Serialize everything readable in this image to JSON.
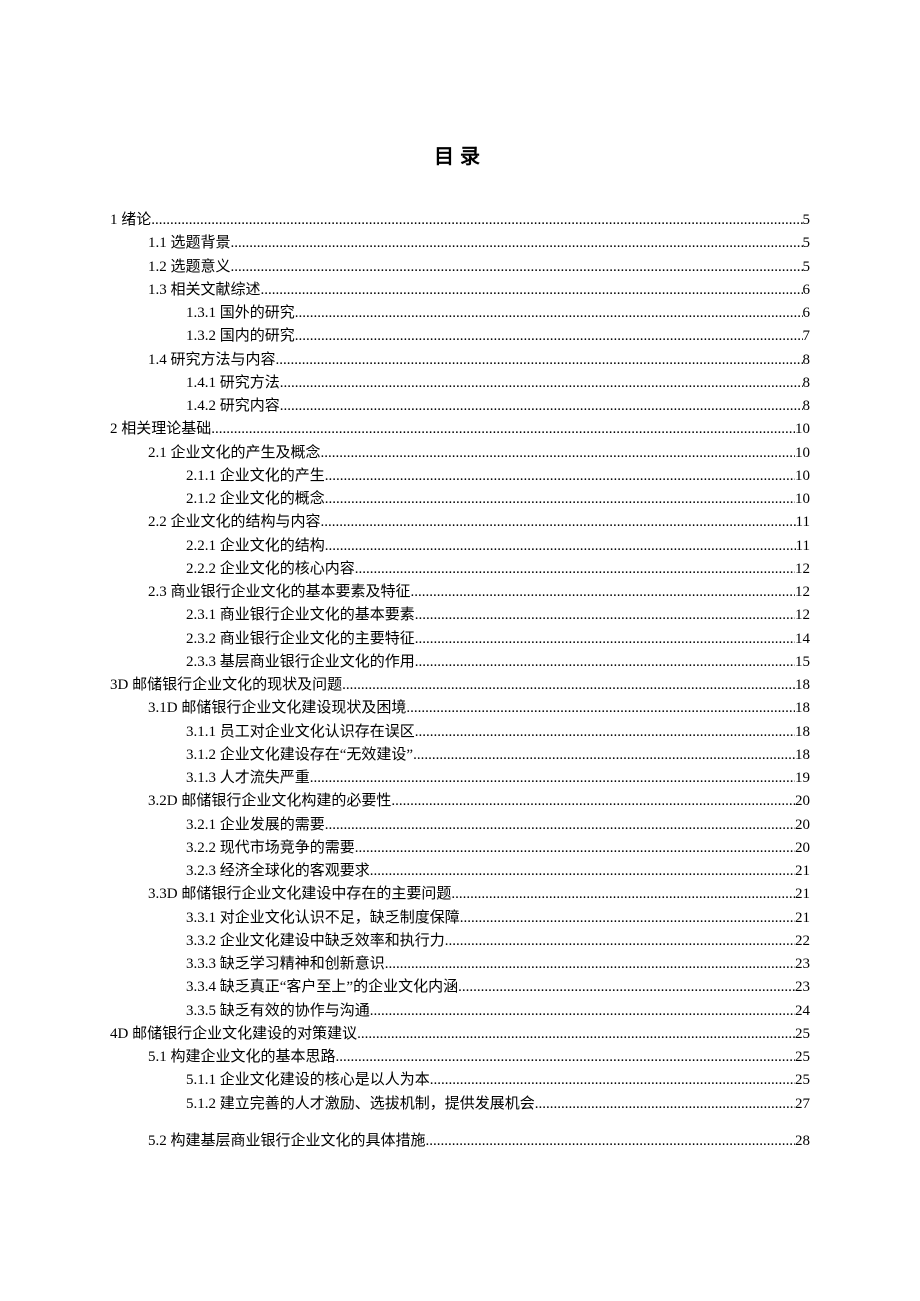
{
  "title": "目录",
  "entries": [
    {
      "level": 0,
      "num": "1 ",
      "text": "绪论 ",
      "page": "5"
    },
    {
      "level": 1,
      "num": "1.1 ",
      "text": "选题背景",
      "page": "5"
    },
    {
      "level": 1,
      "num": "1.2 ",
      "text": "选题意义",
      "page": "5"
    },
    {
      "level": 1,
      "num": "1.3 ",
      "text": "相关文献综述 ",
      "page": "6"
    },
    {
      "level": 2,
      "num": "1.3.1 ",
      "text": "国外的研究",
      "page": "6"
    },
    {
      "level": 2,
      "num": "1.3.2 ",
      "text": "国内的研究",
      "page": "7"
    },
    {
      "level": 1,
      "num": "1.4 ",
      "text": "研究方法与内容",
      "page": "8"
    },
    {
      "level": 2,
      "num": "1.4.1 ",
      "text": "研究方法 ",
      "page": "8"
    },
    {
      "level": 2,
      "num": "1.4.2 ",
      "text": "研究内容 ",
      "page": "8"
    },
    {
      "level": 0,
      "num": "2 ",
      "text": "相关理论基础",
      "page": "10"
    },
    {
      "level": 1,
      "num": "2.1 ",
      "text": "企业文化的产生及概念",
      "page": "10"
    },
    {
      "level": 2,
      "num": "2.1.1 ",
      "text": "企业文化的产生 ",
      "page": "10"
    },
    {
      "level": 2,
      "num": "2.1.2 ",
      "text": "企业文化的概念 ",
      "page": "10"
    },
    {
      "level": 1,
      "num": "2.2 ",
      "text": "企业文化的结构与内容",
      "page": "11"
    },
    {
      "level": 2,
      "num": "2.2.1 ",
      "text": "企业文化的结构 ",
      "page": "11"
    },
    {
      "level": 2,
      "num": "2.2.2 ",
      "text": "企业文化的核心内容 ",
      "page": "12"
    },
    {
      "level": 1,
      "num": "2.3 ",
      "text": "商业银行企业文化的基本要素及特征",
      "page": "12"
    },
    {
      "level": 2,
      "num": "2.3.1 ",
      "text": "商业银行企业文化的基本要素 ",
      "page": "12"
    },
    {
      "level": 2,
      "num": "2.3.2 ",
      "text": "商业银行企业文化的主要特征 ",
      "page": "14"
    },
    {
      "level": 2,
      "num": "2.3.3 ",
      "text": "基层商业银行企业文化的作用 ",
      "page": "15"
    },
    {
      "level": 0,
      "num": "3D ",
      "text": "邮储银行企业文化的现状及问题 ",
      "page": "18"
    },
    {
      "level": 1,
      "num": "3.1D ",
      "text": "邮储银行企业文化建设现状及困境 ",
      "page": "18"
    },
    {
      "level": 2,
      "num": "3.1.1 ",
      "text": "员工对企业文化认识存在误区 ",
      "page": "18"
    },
    {
      "level": 2,
      "num": "3.1.2 ",
      "text": "企业文化建设存在“无效建设”",
      "page": "18"
    },
    {
      "level": 2,
      "num": "3.1.3 ",
      "text": "人才流失严重 ",
      "page": "19"
    },
    {
      "level": 1,
      "num": "3.2D ",
      "text": "邮储银行企业文化构建的必要性 ",
      "page": "20"
    },
    {
      "level": 2,
      "num": "3.2.1 ",
      "text": "企业发展的需要 ",
      "page": "20"
    },
    {
      "level": 2,
      "num": "3.2.2 ",
      "text": "现代市场竞争的需要 ",
      "page": "20"
    },
    {
      "level": 2,
      "num": "3.2.3 ",
      "text": "经济全球化的客观要求 ",
      "page": "21"
    },
    {
      "level": 1,
      "num": "3.3D ",
      "text": "邮储银行企业文化建设中存在的主要问题 ",
      "page": "21"
    },
    {
      "level": 2,
      "num": "3.3.1 ",
      "text": "对企业文化认识不足，缺乏制度保障 ",
      "page": "21"
    },
    {
      "level": 2,
      "num": "3.3.2 ",
      "text": "企业文化建设中缺乏效率和执行力 ",
      "page": "22"
    },
    {
      "level": 2,
      "num": "3.3.3 ",
      "text": "缺乏学习精神和创新意识",
      "page": "23"
    },
    {
      "level": 2,
      "num": "3.3.4 ",
      "text": "缺乏真正“客户至上”的企业文化内涵",
      "page": "23"
    },
    {
      "level": 2,
      "num": "3.3.5 ",
      "text": "缺乏有效的协作与沟通 ",
      "page": "24"
    },
    {
      "level": 0,
      "num": "4D ",
      "text": "邮储银行企业文化建设的对策建议",
      "page": "25"
    },
    {
      "level": 1,
      "num": "5.1 ",
      "text": "构建企业文化的基本思路 ",
      "page": "25"
    },
    {
      "level": 2,
      "num": "5.1.1 ",
      "text": "企业文化建设的核心是以人为本",
      "page": "25"
    },
    {
      "level": 2,
      "num": "5.1.2 ",
      "text": "建立完善的人才激励、选拔机制，提供发展机会 ",
      "page": "27"
    },
    {
      "level": -1,
      "num": "",
      "text": "",
      "page": ""
    },
    {
      "level": 1,
      "num": "5.2 ",
      "text": "构建基层商业银行企业文化的具体措施 ",
      "page": "28"
    }
  ]
}
